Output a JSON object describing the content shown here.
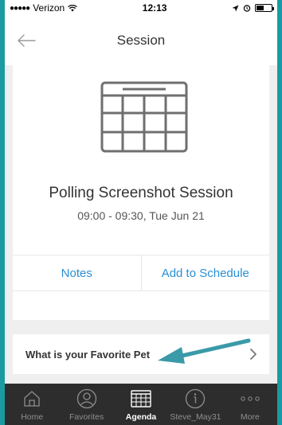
{
  "status_bar": {
    "carrier": "Verizon",
    "time": "12:13"
  },
  "header": {
    "title": "Session"
  },
  "session": {
    "title": "Polling Screenshot Session",
    "time": "09:00 - 09:30, Tue Jun 21",
    "actions": {
      "notes": "Notes",
      "add_to_schedule": "Add to Schedule"
    }
  },
  "poll": {
    "question": "What is your Favorite Pet"
  },
  "tabs": [
    {
      "label": "Home",
      "icon": "home-icon"
    },
    {
      "label": "Favorites",
      "icon": "user-icon"
    },
    {
      "label": "Agenda",
      "icon": "calendar-icon"
    },
    {
      "label": "Steve_May31",
      "icon": "info-icon"
    },
    {
      "label": "More",
      "icon": "more-icon"
    }
  ],
  "colors": {
    "frame": "#1a9ba3",
    "link": "#2a8fd6",
    "tab_bar": "#2d2d2d",
    "annotation_arrow": "#3a9aa8"
  }
}
